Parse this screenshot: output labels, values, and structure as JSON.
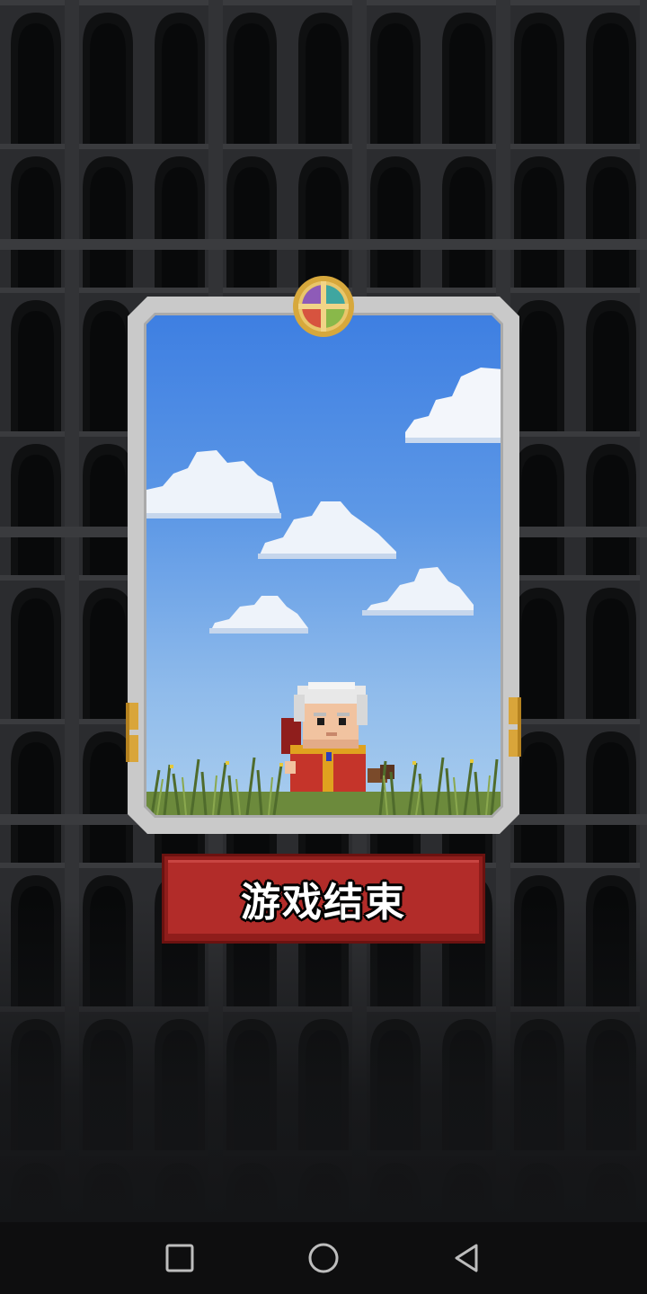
{
  "game_over": {
    "label": "游戏结束"
  },
  "icons": {
    "emblem": "four-color-compass-emblem-icon",
    "nav_recent": "square-recent-apps-icon",
    "nav_home": "circle-home-icon",
    "nav_back": "triangle-back-icon"
  },
  "colors": {
    "button_red": "#b22c29",
    "card_frame": "#c9c9c9",
    "sky_top": "#3e7fe2",
    "background": "#1c1d1f"
  }
}
